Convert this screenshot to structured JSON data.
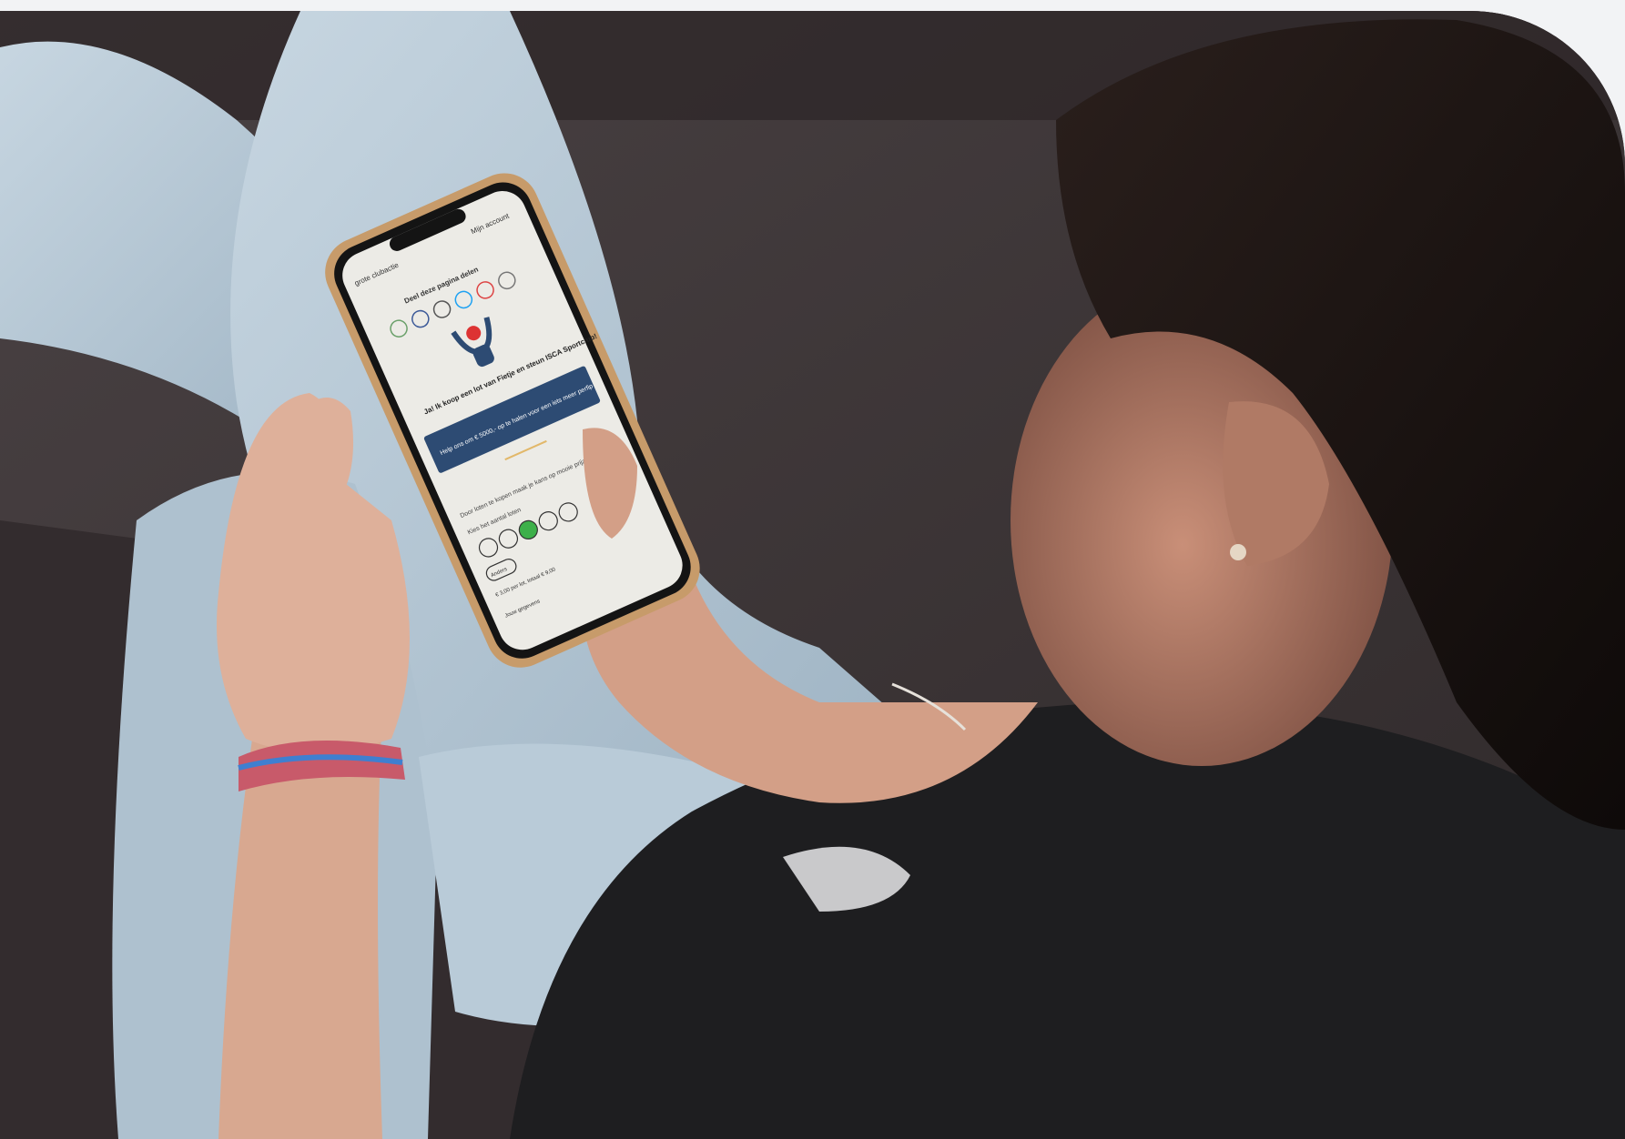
{
  "photo": {
    "alt_subject": "person on a sofa holding a smartphone",
    "phone": {
      "header_left": "grote clubactie",
      "header_right": "Mijn account",
      "share_heading": "Deel deze pagina delen",
      "share_icons": [
        "whatsapp-icon",
        "facebook-icon",
        "mail-icon",
        "twitter-icon",
        "gmail-icon",
        "link-icon"
      ],
      "headline": "Ja! Ik koop een lot van Fietje en steun ISCA Sportclub!",
      "banner_text": "Help ons om € 5000,- op te halen voor een iets meer perfip",
      "body_text": "Door loten te kopen maak je kans op mooie prijzen!",
      "count_label": "Kies het aantal loten",
      "count_options": [
        "5",
        "4",
        "3",
        "2",
        "1"
      ],
      "selected_count": "3",
      "button_label": "Anders",
      "price_text": "€ 3,00 per lot, totaal € 9,00",
      "footer_text": "Jouw gegevens"
    },
    "colors": {
      "sofa": "#3a3436",
      "jeans": "#b7c9d6",
      "shirt": "#1e1e20",
      "skin": "#d8a890",
      "hair": "#1a1312",
      "phone_banner": "#2d4b73",
      "selected_green": "#3db04a",
      "phone_case": "#c79b6a"
    }
  }
}
